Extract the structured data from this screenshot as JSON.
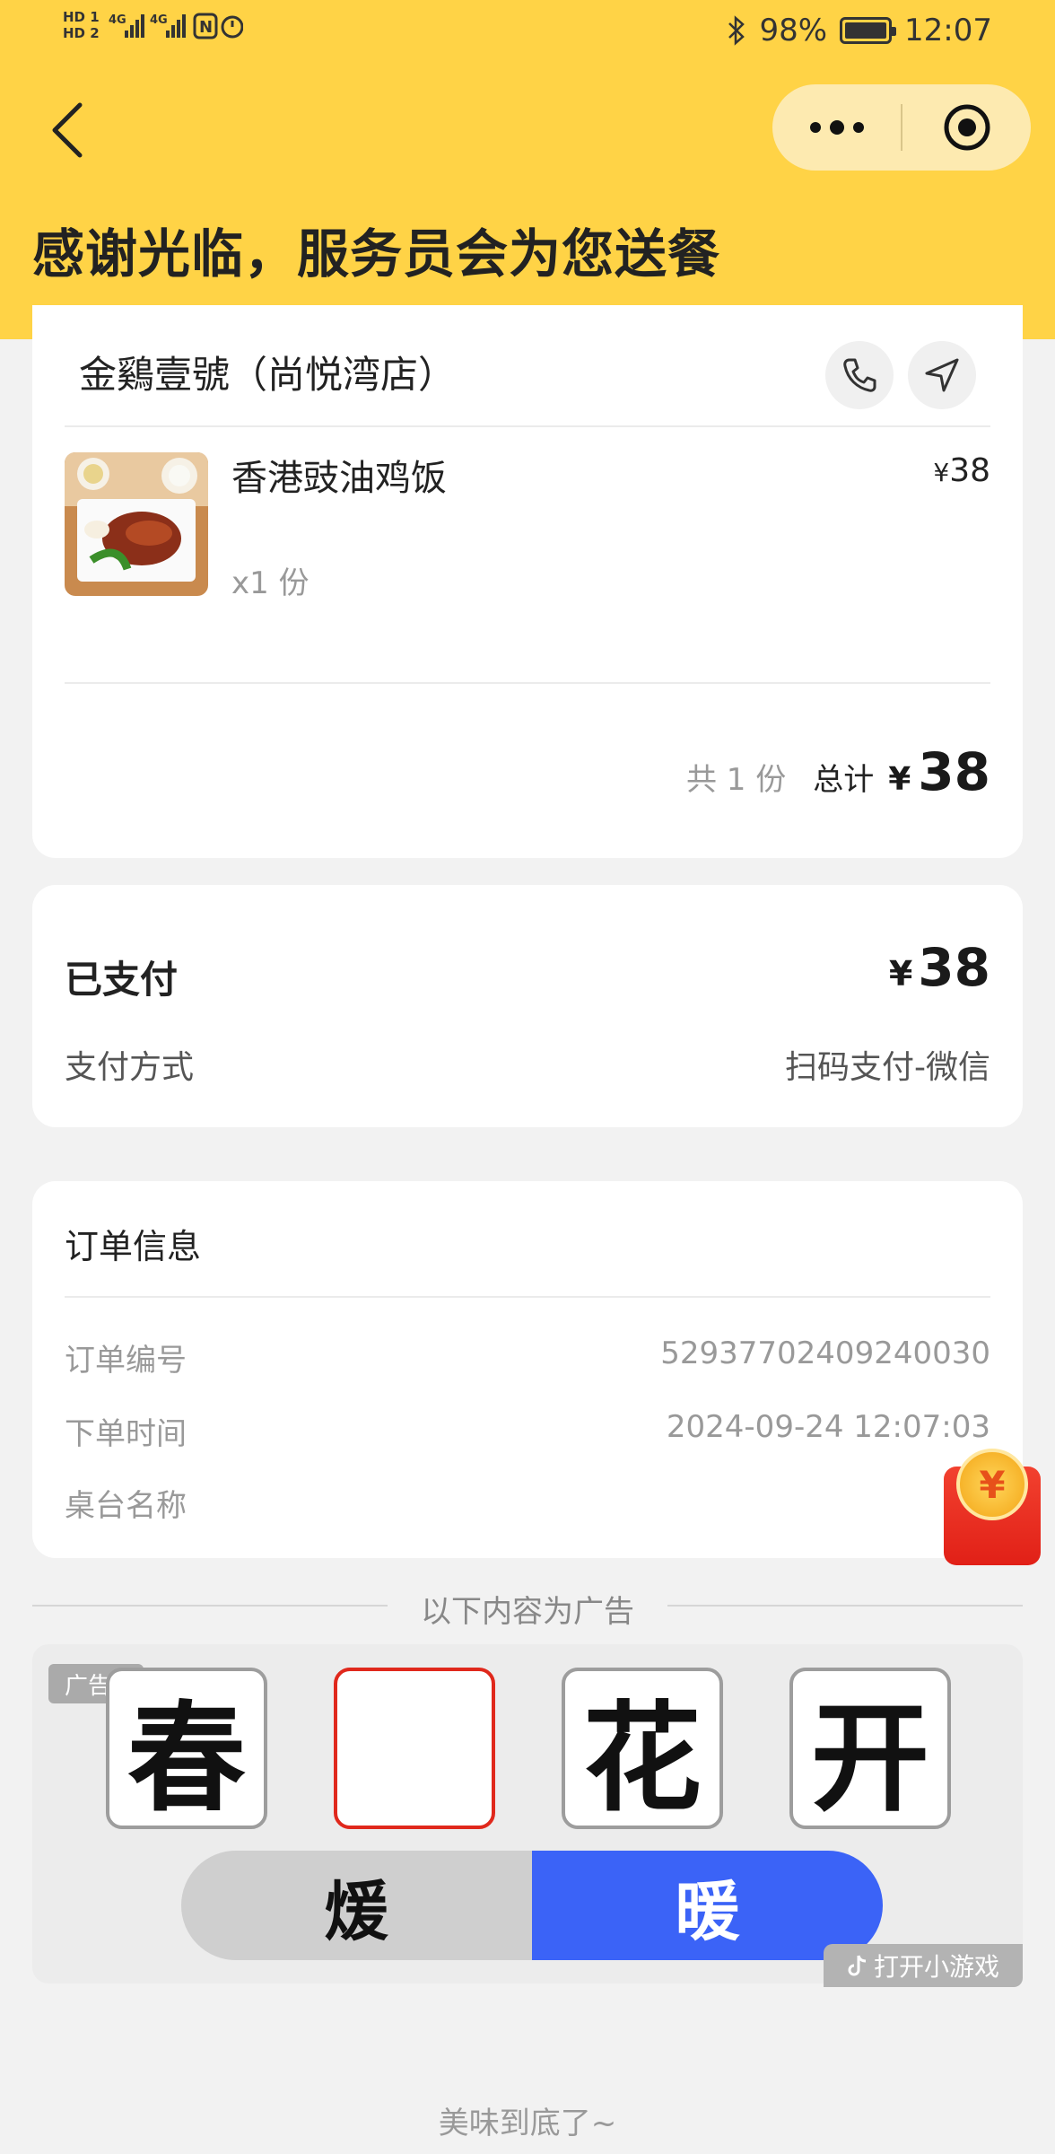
{
  "status_bar": {
    "hd1": "HD 1",
    "hd2": "HD 2",
    "network": "4G 4G",
    "battery_pct": "98%",
    "time": "12:07"
  },
  "header": {
    "title": "感谢光临，服务员会为您送餐",
    "back_icon": "chevron-left-icon",
    "menu_icon": "more-dots-icon",
    "close_icon": "target-circle-icon"
  },
  "order": {
    "store_name": "金鷄壹號（尚悦湾店）",
    "item": {
      "name": "香港豉油鸡饭",
      "qty": "x1 份",
      "price_yen": "¥",
      "price": "38"
    },
    "summary": {
      "count": "共 1 份",
      "total_label": "总计",
      "yen": "¥",
      "total": "38"
    }
  },
  "payment": {
    "status": "已支付",
    "yen": "¥",
    "amount": "38",
    "method_label": "支付方式",
    "method_value": "扫码支付-微信"
  },
  "order_info": {
    "title": "订单信息",
    "rows": [
      {
        "label": "订单编号",
        "value": "52937702409240030"
      },
      {
        "label": "下单时间",
        "value": "2024-09-24 12:07:03"
      },
      {
        "label": "桌台名称",
        "value": ""
      }
    ]
  },
  "red_packet": {
    "symbol": "¥"
  },
  "ad": {
    "divider_text": "以下内容为广告",
    "tag": "广告",
    "tiles": [
      "春",
      "",
      "花",
      "开"
    ],
    "choices": [
      "煖",
      "暖"
    ],
    "open_game": "打开小游戏"
  },
  "footer": {
    "text": "美味到底了~"
  },
  "colors": {
    "header_bg": "#ffd346",
    "accent_blue": "#3b63f7",
    "accent_red": "#e0281c"
  }
}
